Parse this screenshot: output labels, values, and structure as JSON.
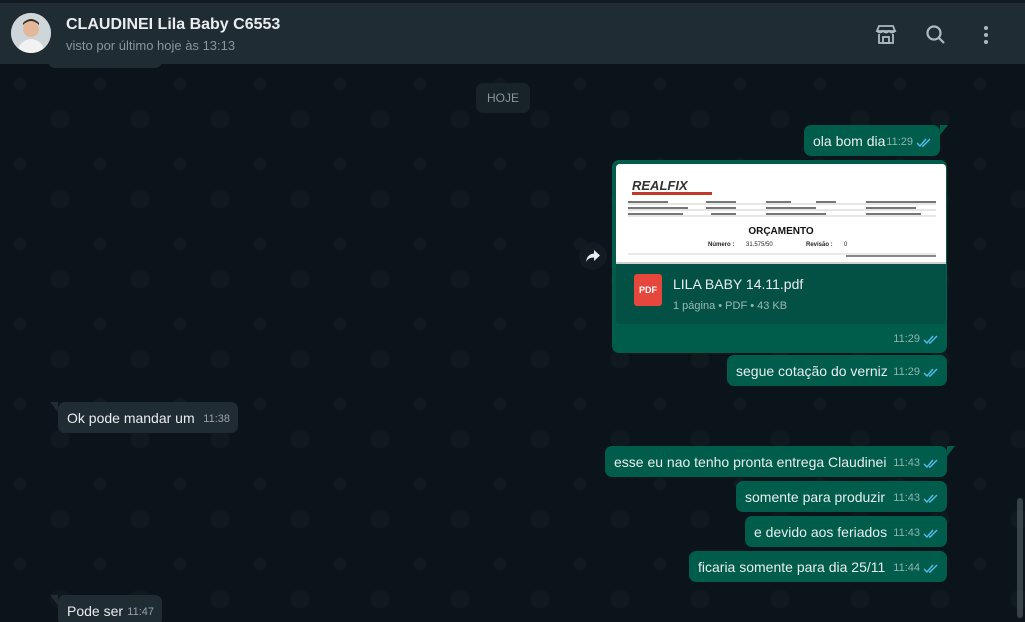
{
  "header": {
    "contact_name": "CLAUDINEI Lila Baby C6553",
    "status": "visto por último hoje às 13:13",
    "icons": [
      "catalog-icon",
      "search-icon",
      "menu-icon"
    ]
  },
  "chat": {
    "date_chip": "HOJE",
    "messages": [
      {
        "dir": "out",
        "text": "ola bom dia",
        "time": "11:29"
      },
      {
        "dir": "out",
        "type": "document",
        "preview": {
          "brand": "REALFIX",
          "title": "ORÇAMENTO",
          "number_label": "Número :",
          "number": "31.575/50",
          "revision_label": "Revisão :",
          "revision": "0"
        },
        "file_name": "LILA BABY 14.11.pdf",
        "file_details": "1 página • PDF • 43 KB",
        "badge": "PDF",
        "time": "11:29"
      },
      {
        "dir": "out",
        "text": "segue cotação do verniz",
        "time": "11:29"
      },
      {
        "dir": "in",
        "text": "Ok pode mandar um",
        "time": "11:38"
      },
      {
        "dir": "out",
        "text": "esse eu nao tenho pronta entrega Claudinei",
        "time": "11:43"
      },
      {
        "dir": "out",
        "text": "somente para produzir",
        "time": "11:43"
      },
      {
        "dir": "out",
        "text": "e devido aos feriados",
        "time": "11:43"
      },
      {
        "dir": "out",
        "text": "ficaria somente para dia 25/11",
        "time": "11:44"
      },
      {
        "dir": "in",
        "text": "Pode ser",
        "time": "11:47"
      }
    ]
  },
  "colors": {
    "header_bg": "#202c33",
    "chat_bg": "#0b141a",
    "outgoing_bubble": "#005c4b",
    "incoming_bubble": "#202c33",
    "read_ticks": "#53bdeb"
  }
}
